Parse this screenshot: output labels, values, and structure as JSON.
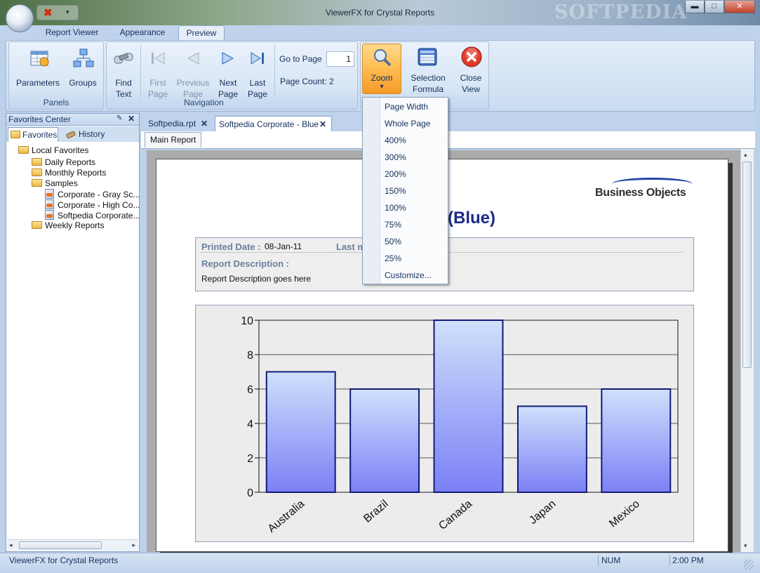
{
  "window": {
    "title": "ViewerFX for Crystal Reports",
    "watermark": "SOFTPEDIA",
    "controls": {
      "minimize": "▬",
      "maximize": "□",
      "close": "✕"
    }
  },
  "quick_access": {
    "close_glyph": "✖",
    "dropdown_glyph": "▾"
  },
  "ribbon": {
    "tabs": [
      "Report Viewer",
      "Appearance",
      "Preview"
    ],
    "active_tab": "Preview",
    "groups": {
      "panels": {
        "label": "Panels",
        "buttons": [
          "Parameters",
          "Groups"
        ]
      },
      "navigation": {
        "label": "Navigation",
        "find": [
          "Find",
          "Text"
        ],
        "first": [
          "First",
          "Page"
        ],
        "previous": [
          "Previous",
          "Page"
        ],
        "next": [
          "Next",
          "Page"
        ],
        "last": [
          "Last",
          "Page"
        ],
        "go_to_page_label": "Go to Page",
        "go_to_page_value": "1",
        "page_count": "Page Count: 2"
      },
      "zoom": {
        "label": "Zoom",
        "arrow": "▾"
      },
      "formula": {
        "line1": "Selection",
        "line2": "Formula"
      },
      "close": {
        "line1": "Close",
        "line2": "View"
      }
    }
  },
  "zoom_menu": {
    "items": [
      "Page Width",
      "Whole Page",
      "400%",
      "300%",
      "200%",
      "150%",
      "100%",
      "75%",
      "50%",
      "25%",
      "Customize..."
    ]
  },
  "favorites": {
    "header": "Favorites Center",
    "pin": "✎",
    "close": "✕",
    "tabs": [
      "Favorites",
      "History"
    ],
    "tree": {
      "root": "Local Favorites",
      "folders": [
        "Daily Reports",
        "Monthly Reports",
        "Samples"
      ],
      "samples": [
        "Corporate - Gray Sc...",
        "Corporate - High Co...",
        "Softpedia  Corporate..."
      ],
      "last": "Weekly Reports"
    }
  },
  "documents": {
    "tabs": [
      "Softpedia.rpt",
      "Softpedia Corporate - Blue"
    ],
    "tab_close": "✕",
    "subtab": "Main Report"
  },
  "report": {
    "logo": "Business Objects",
    "title_visible": "te (Blue)",
    "printed_date_label": "Printed Date :",
    "printed_date": "08-Jan-11",
    "last_mod_label": "Last m",
    "description_label": "Report Description :",
    "description": "Report Description goes here"
  },
  "chart_data": {
    "type": "bar",
    "categories": [
      "Australia",
      "Brazil",
      "Canada",
      "Japan",
      "Mexico"
    ],
    "values": [
      7,
      6,
      10,
      5,
      6
    ],
    "ylim": [
      0,
      10
    ],
    "yticks": [
      0,
      2,
      4,
      6,
      8,
      10
    ],
    "grid": true,
    "colors": {
      "bar_top": "#cfe0fb",
      "bar_bottom": "#7b80f5",
      "outline": "#101a78"
    }
  },
  "status": {
    "app": "ViewerFX for Crystal Reports",
    "num": "NUM",
    "time": "2:00 PM"
  }
}
